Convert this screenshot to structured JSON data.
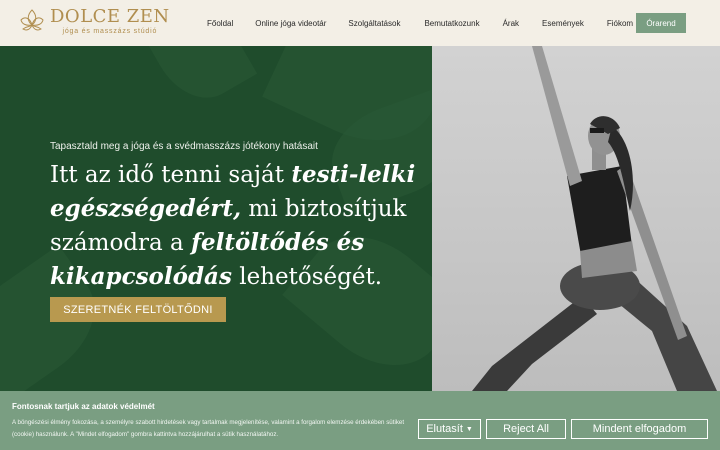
{
  "header": {
    "logo_name": "DOLCE ZEN",
    "logo_tagline": "jóga és masszázs stúdió",
    "nav": [
      "Főoldal",
      "Online jóga videotár",
      "Szolgáltatások",
      "Bemutatkozunk",
      "Árak",
      "Események",
      "Fiókom"
    ],
    "book_label": "Órarend"
  },
  "hero": {
    "subtitle": "Tapasztald meg a jóga és a svédmasszázs jótékony hatásait",
    "title_1": "Itt az idő tenni saját ",
    "title_2": "testi-lelki egészségedért,",
    "title_3": " mi biztosítjuk számodra a ",
    "title_4": "feltöltődés és kikapcsolódás",
    "title_5": " lehetőségét.",
    "cta_label": "SZERETNÉK FELTÖLTŐDNI"
  },
  "cookie": {
    "title": "Fontosnak tartjuk az adatok védelmét",
    "text": "A böngészési élmény fokozása, a személyre szabott hirdetések vagy tartalmak megjelenítése, valamint a forgalom elemzése érdekében sütiket (cookie) használunk. A \"Mindet elfogadom\" gombra kattintva hozzájárulhat a sütik használatához.",
    "reject_menu_label": "Elutasít",
    "reject_all_label": "Reject All",
    "accept_all_label": "Mindent elfogadom"
  },
  "colors": {
    "brand_gold": "#b08e4f",
    "hero_green": "#1f4c2c",
    "sage": "#7a9e82",
    "cta_gold": "#b8994f",
    "header_bg": "#f3efe6"
  },
  "icons": {
    "logo": "lotus-flower-icon",
    "dropdown": "caret-down-icon"
  }
}
